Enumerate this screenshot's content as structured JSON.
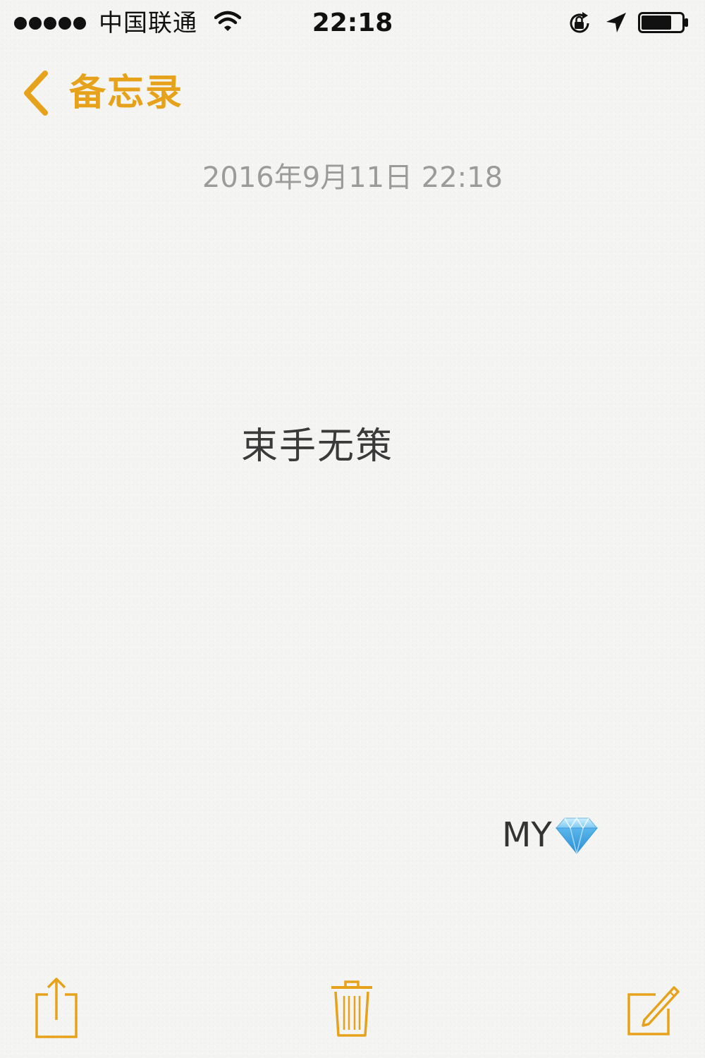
{
  "status_bar": {
    "signal_bars": 5,
    "carrier": "中国联通",
    "time": "22:18",
    "battery_level": 0.75,
    "icons": [
      "signal-dots",
      "wifi-icon",
      "rotation-lock-icon",
      "location-arrow-icon",
      "battery-icon"
    ]
  },
  "nav": {
    "back_label": "备忘录",
    "back_icon": "chevron-left-icon"
  },
  "note": {
    "date": "2016年9月11日 22:18",
    "body": "束手无策",
    "signature": "MY",
    "signature_icon": "gem-icon"
  },
  "toolbar": {
    "icons": [
      "share-icon",
      "trash-icon",
      "compose-icon"
    ]
  },
  "colors": {
    "accent": "#e6a21a",
    "background": "#f4f4f2",
    "date_text": "#9b9b9b",
    "body_text": "#3a3a3a"
  }
}
